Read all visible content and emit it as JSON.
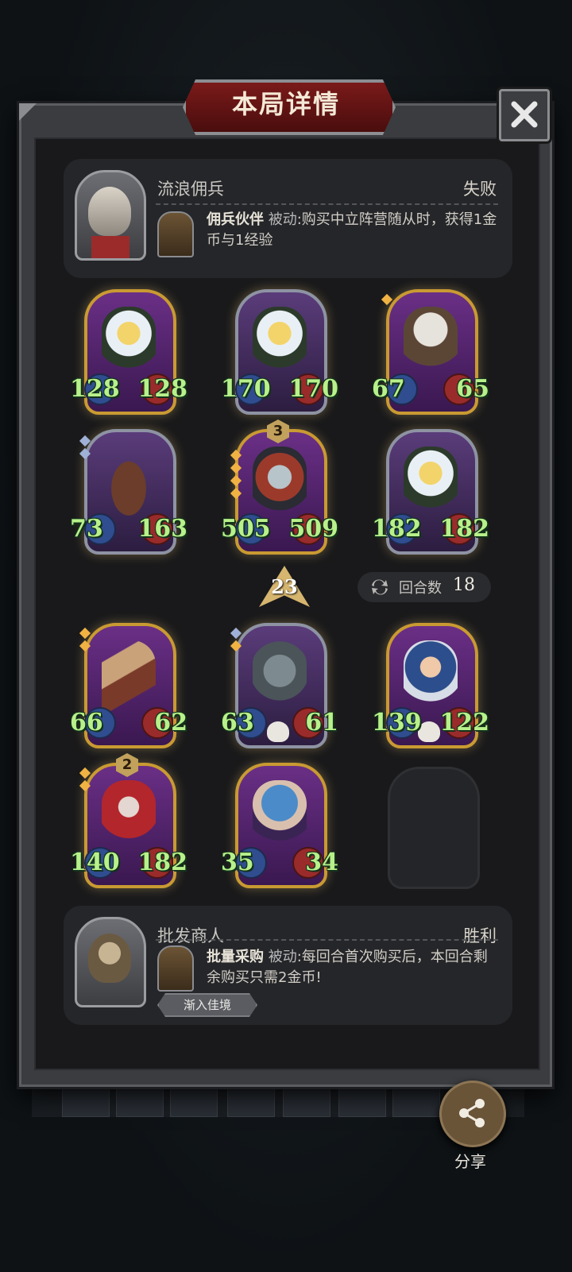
{
  "title": "本局详情",
  "top_card": {
    "name": "流浪佣兵",
    "result": "失败",
    "ability_name": "佣兵伙伴",
    "ability_type": "被动",
    "ability_desc": ":购买中立阵营随从时，获得1金币与1经验"
  },
  "bottom_card": {
    "name": "批发商人",
    "result": "胜利",
    "ability_name": "批量采购",
    "ability_type": "被动",
    "ability_desc": ":每回合首次购买后，本回合剩余购买只需2金币!",
    "tag": "渐入佳境"
  },
  "tier": "23",
  "round": {
    "label": "回合数",
    "value": "18"
  },
  "share_label": "分享",
  "units_row1": [
    {
      "atk": "128",
      "hp": "128"
    },
    {
      "atk": "170",
      "hp": "170"
    },
    {
      "atk": "67",
      "hp": "65"
    }
  ],
  "units_row2": [
    {
      "atk": "73",
      "hp": "163"
    },
    {
      "atk": "505",
      "hp": "509",
      "badge": "3"
    },
    {
      "atk": "182",
      "hp": "182"
    }
  ],
  "units_row3": [
    {
      "atk": "66",
      "hp": "62"
    },
    {
      "atk": "63",
      "hp": "61"
    },
    {
      "atk": "139",
      "hp": "122"
    }
  ],
  "units_row4": [
    {
      "atk": "140",
      "hp": "182",
      "badge": "2"
    },
    {
      "atk": "35",
      "hp": "34"
    }
  ],
  "colors": {
    "accent_gold": "#c99a32",
    "stat_green": "#b8f08a",
    "title_red": "#7a1a1a"
  }
}
